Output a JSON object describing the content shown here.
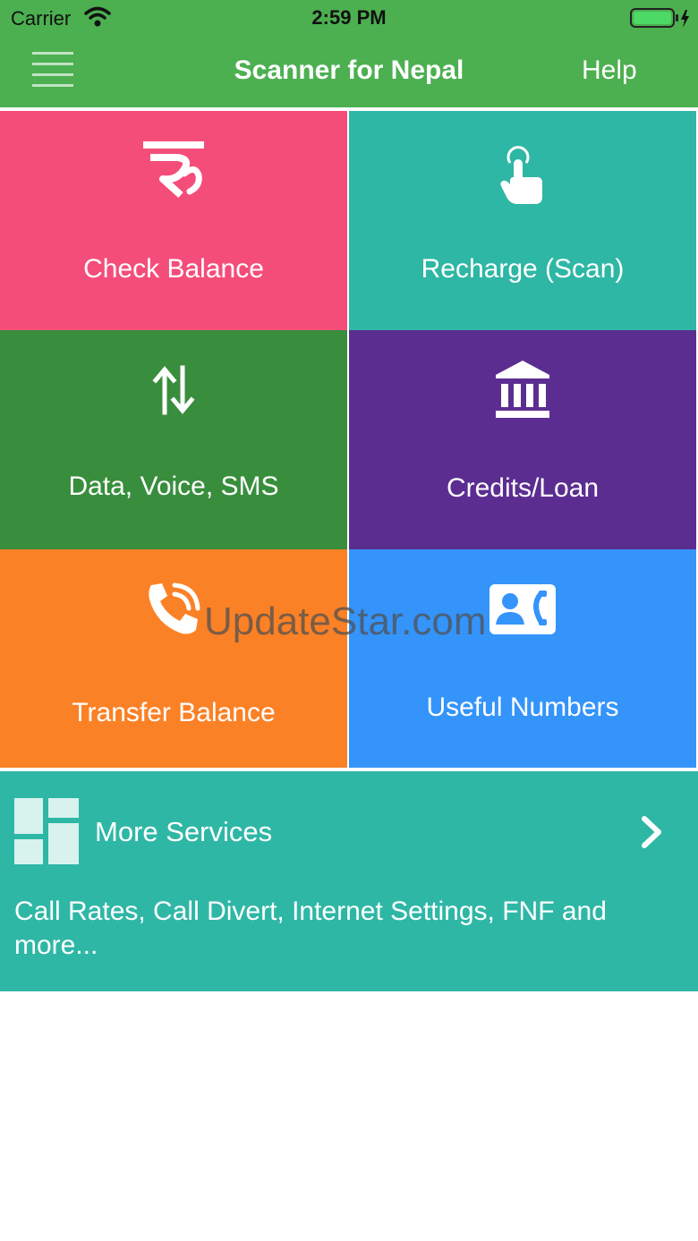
{
  "status_bar": {
    "carrier": "Carrier",
    "time": "2:59 PM"
  },
  "navbar": {
    "title": "Scanner for Nepal",
    "help_label": "Help"
  },
  "tiles": [
    {
      "label": "Check Balance",
      "icon": "rupee-icon",
      "color": "#f54d7a"
    },
    {
      "label": "Recharge (Scan)",
      "icon": "tap-finger-icon",
      "color": "#2eb7a4"
    },
    {
      "label": "Data, Voice, SMS",
      "icon": "up-down-arrows-icon",
      "color": "#388e3c"
    },
    {
      "label": "Credits/Loan",
      "icon": "bank-icon",
      "color": "#5c2d91"
    },
    {
      "label": "Transfer Balance",
      "icon": "phone-call-icon",
      "color": "#fb8126"
    },
    {
      "label": "Useful Numbers",
      "icon": "contact-card-icon",
      "color": "#3494fa"
    }
  ],
  "more_services": {
    "title": "More Services",
    "description": "Call Rates, Call Divert, Internet Settings, FNF and more...",
    "color": "#2fb7a6"
  },
  "watermark": "UpdateStar.com"
}
